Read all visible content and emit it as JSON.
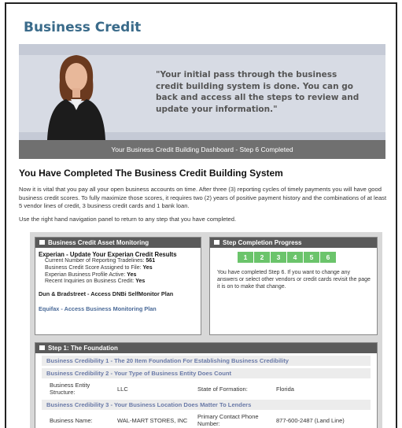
{
  "page": {
    "title": "Business Credit",
    "quote": "\"Your initial pass through the business credit building system is done. You can go back and access all the steps to review and update your information.\"",
    "dashboard_bar": "Your Business Credit Building Dashboard - Step 6 Completed",
    "heading": "You Have Completed The Business Credit Building System",
    "paragraph": "Now it is vital that you pay all your open business accounts on time. After three (3) reporting cycles of timely payments you will have good business credit scores. To fully maximize those scores, it requires two (2) years of positive payment history and the combinations of at least 5 vendor lines of credit, 3 business credit cards and 1 bank loan.",
    "paragraph2": "Use the right hand navigation panel to return to any step that you have completed."
  },
  "monitoring": {
    "title": "Business Credit Asset Monitoring",
    "experian_title": "Experian - Update Your Experian Credit Results",
    "rows": [
      {
        "label": "Current Number of Reporting Tradelines:",
        "value": "561"
      },
      {
        "label": "Business Credit Score Assigned to File:",
        "value": "Yes"
      },
      {
        "label": "Experian Business Profile Active:",
        "value": "Yes"
      },
      {
        "label": "Recent Inquiries on Business Credit:",
        "value": "Yes"
      }
    ],
    "dnb": "Dun & Bradstreet - Access DNBi SelfMonitor Plan",
    "equifax": "Equifax - Access Business Monitoring Plan"
  },
  "progress": {
    "title": "Step Completion Progress",
    "steps": [
      "1",
      "2",
      "3",
      "4",
      "5",
      "6"
    ],
    "note": "You have completed Step 6. If you want to change any answers or select other vendors or credit cards revisit the page it is on to make that change."
  },
  "foundation": {
    "title": "Step 1: The Foundation",
    "credibility1": "Business Credibility 1 - The 20 Item Foundation For Establishing Business Credibility",
    "credibility2": "Business Credibility 2 - Your Type of Business Entity Does Count",
    "entity_label": "Business Entity Structure:",
    "entity_value": "LLC",
    "state_label": "State of Formation:",
    "state_value": "Florida",
    "credibility3": "Business Credibility 3 - Your Business Location Does Matter To Lenders",
    "name_label": "Business Name:",
    "name_value": "WAL-MART STORES, INC",
    "phone_label": "Primary Contact Phone Number:",
    "phone_value": "877-600-2487 (Land Line)"
  },
  "colors": {
    "title": "#3a6b8a",
    "step_green": "#6bc46b",
    "bar_gray": "#707070"
  }
}
